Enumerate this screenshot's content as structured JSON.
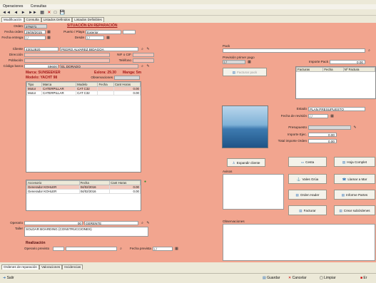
{
  "menu": [
    "Operaciones",
    "Consultas"
  ],
  "toolbar": {
    "first": "◄◄",
    "prev": "◄",
    "next": "►",
    "last": "►►",
    "grid": "▦",
    "delete": "✕",
    "blank": "□",
    "save": "💾"
  },
  "tabs": [
    "Modificación",
    "Consulta",
    "Listados Definidos",
    "Listados Definibles"
  ],
  "form": {
    "orden_label": "Orden",
    "orden_value": "279271",
    "situacion_label": "SITUACIÓN EN REPARACIÓN",
    "fecha_orden_label": "Fecha orden",
    "fecha_orden_value": "29/08/2015",
    "puerto_label": "Puerto / Playa",
    "puerto_value": "Exterior",
    "fecha_entrega_label": "Fecha entrega",
    "fecha_entrega_value": "/ /",
    "desde_label": "Desde",
    "desde_value": "/ /",
    "cliente_label": "Cliente",
    "cliente_code": "43012820",
    "cliente_name": "PEDRO ALVAREZ BIDAGOA",
    "direccion_label": "Dirección",
    "nif_label": "NIF o CIF",
    "poblacion_label": "Población",
    "telefono_label": "Teléfono",
    "codigo_label": "Código barco",
    "codigo_value": "S9600",
    "codigo_name": "EL DORADO",
    "marca": "Marca: SUNSEEKER",
    "modelo": "Modelo: YACHT 98",
    "eslora": "Eslora: 29.30",
    "manga": "Manga: 5m",
    "observaciones_label": "Observaciones",
    "operario_label": "Operario",
    "operario_code": "00",
    "operario_name": "GERENTE",
    "taller_label": "Taller",
    "taller_value": "SOLDAR BOARDING (CONSTRUCCIONES)",
    "realizacion_label": "Realización",
    "operario_previsto_label": "Operario previsto",
    "fecha_prevista_label": "Fecha prevista",
    "fecha_prevista_value": "/ /"
  },
  "engines": {
    "headers": [
      "Tipo",
      "Marca",
      "Modelo",
      "Fecha",
      "Cant Horas"
    ],
    "rows": [
      [
        "Motor",
        "CATERPILLAR",
        "CAT C32",
        "",
        "0.00"
      ],
      [
        "Motor",
        "CATERPILLAR",
        "CAT C32",
        "",
        "0.00"
      ]
    ]
  },
  "accessories": {
    "headers": [
      "Accesorio",
      "Fecha",
      "Cant Horas"
    ],
    "rows": [
      [
        "Generador KOHLER",
        "04/02/2016",
        "0.00"
      ],
      [
        "Generador KOHLER",
        "04/02/2016",
        "0.00"
      ]
    ]
  },
  "right": {
    "pack_label": "Pack",
    "recordar_label": "Previsión primer pago",
    "recordar_value": "/ /",
    "importe_pack_label": "Importe Pack",
    "importe_pack_value": "0.00",
    "fact_headers": [
      "Facturas",
      "Fecha",
      "Nº Factura"
    ],
    "crear_pago_label": "Facturar pack",
    "estado_label": "Estado",
    "estado_value": "PLAN PRESUPUESTO",
    "fecha_revision_label": "Fecha de revisión",
    "fecha_revision_value": "/ /",
    "presupuesto_label": "Presupuesto",
    "importe_ejec_label": "Importe Ejec.",
    "importe_ejec_value": "0.00",
    "total_importe_label": "Total importe Orden",
    "total_importe_value": "0.00",
    "expandir_label": "Expandir cliente",
    "avisos_label": "Avisos",
    "observaciones_label": "Observaciones",
    "btn_cesta": "Cesta",
    "btn_hoja": "Hoja Complet",
    "btn_vales": "Vales Grúa",
    "btn_llamar": "Llamar a Mar",
    "btn_ordenes": "Orden Hader",
    "btn_informe": "Informe Partes",
    "btn_facturar": "Facturar",
    "btn_crear": "Crear subórdenes"
  },
  "bottom_tabs": [
    "Ordenes de reparación",
    "Valoraciones",
    "Incidencias"
  ],
  "status": {
    "salir": "Salir",
    "guardar": "Guardar",
    "cancelar": "Cancelar",
    "limpiar": "Limpiar",
    "extra": "Er"
  },
  "colors": {
    "panel": "#f2a58f",
    "accent": "#a21818"
  }
}
